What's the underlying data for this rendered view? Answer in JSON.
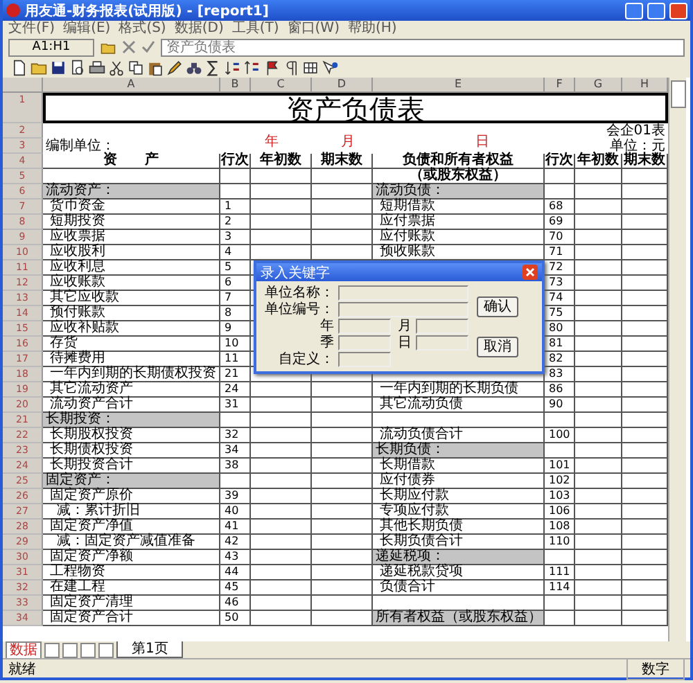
{
  "window": {
    "title": "用友通-财务报表(试用版) - [report1]"
  },
  "menu": [
    "文件(F)",
    "编辑(E)",
    "格式(S)",
    "数据(D)",
    "工具(T)",
    "窗口(W)",
    "帮助(H)"
  ],
  "formula_bar": {
    "cell": "A1:H1",
    "content": "资产负债表"
  },
  "columns": [
    "A",
    "B",
    "C",
    "D",
    "E",
    "F",
    "G",
    "H"
  ],
  "sheet": {
    "top_rows": [
      "1",
      "2",
      "3",
      "4",
      "5"
    ],
    "title": "资产负债表",
    "form_no": "会企01表",
    "unit_label": "编制单位：",
    "date_parts": [
      "年",
      "月",
      "日"
    ],
    "currency": "单位：元",
    "header": [
      "资　　产",
      "行次",
      "年初数",
      "期末数",
      "负债和所有者权益",
      "行次",
      "年初数",
      "期末数"
    ],
    "header2": "（或股东权益）",
    "rows": [
      {
        "num": "6",
        "asset": {
          "kind": "section",
          "text": "流动资产："
        },
        "liab": {
          "kind": "section",
          "text": "流动负债："
        }
      },
      {
        "num": "7",
        "asset": {
          "kind": "item",
          "text": "货币资金",
          "line": "1"
        },
        "liab": {
          "kind": "item",
          "text": "短期借款",
          "line": "68"
        }
      },
      {
        "num": "8",
        "asset": {
          "kind": "item",
          "text": "短期投资",
          "line": "2"
        },
        "liab": {
          "kind": "item",
          "text": "应付票据",
          "line": "69"
        }
      },
      {
        "num": "9",
        "asset": {
          "kind": "item",
          "text": "应收票据",
          "line": "3"
        },
        "liab": {
          "kind": "item",
          "text": "应付账款",
          "line": "70"
        }
      },
      {
        "num": "10",
        "asset": {
          "kind": "item",
          "text": "应收股利",
          "line": "4"
        },
        "liab": {
          "kind": "item",
          "text": "预收账款",
          "line": "71"
        }
      },
      {
        "num": "11",
        "asset": {
          "kind": "item",
          "text": "应收利息",
          "line": "5"
        },
        "liab": {
          "kind": "item",
          "line": "72"
        }
      },
      {
        "num": "12",
        "asset": {
          "kind": "item",
          "text": "应收账款",
          "line": "6"
        },
        "liab": {
          "kind": "item",
          "line": "73"
        }
      },
      {
        "num": "13",
        "asset": {
          "kind": "item",
          "text": "其它应收款",
          "line": "7"
        },
        "liab": {
          "kind": "item",
          "line": "74"
        }
      },
      {
        "num": "14",
        "asset": {
          "kind": "item",
          "text": "预付账款",
          "line": "8"
        },
        "liab": {
          "kind": "item",
          "line": "75"
        }
      },
      {
        "num": "15",
        "asset": {
          "kind": "item",
          "text": "应收补贴款",
          "line": "9"
        },
        "liab": {
          "kind": "item",
          "line": "80"
        }
      },
      {
        "num": "16",
        "asset": {
          "kind": "item",
          "text": "存货",
          "line": "10"
        },
        "liab": {
          "kind": "item",
          "line": "81"
        }
      },
      {
        "num": "17",
        "asset": {
          "kind": "item",
          "text": "待摊费用",
          "line": "11"
        },
        "liab": {
          "kind": "item",
          "line": "82"
        }
      },
      {
        "num": "18",
        "asset": {
          "kind": "item",
          "text": "一年内到期的长期债权投资",
          "line": "21"
        },
        "liab": {
          "kind": "item",
          "line": "83"
        }
      },
      {
        "num": "19",
        "asset": {
          "kind": "item",
          "text": "其它流动资产",
          "line": "24"
        },
        "liab": {
          "kind": "item",
          "text": "一年内到期的长期负债",
          "line": "86"
        }
      },
      {
        "num": "20",
        "asset": {
          "kind": "item",
          "text": "流动资产合计",
          "line": "31"
        },
        "liab": {
          "kind": "item",
          "text": "其它流动负债",
          "line": "90"
        }
      },
      {
        "num": "21",
        "asset": {
          "kind": "section",
          "text": "长期投资："
        },
        "liab": {
          "kind": "item"
        }
      },
      {
        "num": "22",
        "asset": {
          "kind": "item",
          "text": "长期股权投资",
          "line": "32"
        },
        "liab": {
          "kind": "item",
          "text": "流动负债合计",
          "line": "100"
        }
      },
      {
        "num": "23",
        "asset": {
          "kind": "item",
          "text": "长期债权投资",
          "line": "34"
        },
        "liab": {
          "kind": "section",
          "text": "长期负债："
        }
      },
      {
        "num": "24",
        "asset": {
          "kind": "item",
          "text": "长期投资合计",
          "line": "38"
        },
        "liab": {
          "kind": "item",
          "text": "长期借款",
          "line": "101"
        }
      },
      {
        "num": "25",
        "asset": {
          "kind": "section",
          "text": "固定资产："
        },
        "liab": {
          "kind": "item",
          "text": "应付债券",
          "line": "102"
        }
      },
      {
        "num": "26",
        "asset": {
          "kind": "item",
          "text": "固定资产原价",
          "line": "39"
        },
        "liab": {
          "kind": "item",
          "text": "长期应付款",
          "line": "103"
        }
      },
      {
        "num": "27",
        "asset": {
          "kind": "sub",
          "text": "减：累计折旧",
          "line": "40"
        },
        "liab": {
          "kind": "item",
          "text": "专项应付款",
          "line": "106"
        }
      },
      {
        "num": "28",
        "asset": {
          "kind": "item",
          "text": "固定资产净值",
          "line": "41"
        },
        "liab": {
          "kind": "item",
          "text": "其他长期负债",
          "line": "108"
        }
      },
      {
        "num": "29",
        "asset": {
          "kind": "sub",
          "text": "减：固定资产减值准备",
          "line": "42"
        },
        "liab": {
          "kind": "item",
          "text": "长期负债合计",
          "line": "110"
        }
      },
      {
        "num": "30",
        "asset": {
          "kind": "item",
          "text": "固定资产净额",
          "line": "43"
        },
        "liab": {
          "kind": "section",
          "text": "递延税项："
        }
      },
      {
        "num": "31",
        "asset": {
          "kind": "item",
          "text": "工程物资",
          "line": "44"
        },
        "liab": {
          "kind": "item",
          "text": "递延税款贷项",
          "line": "111"
        }
      },
      {
        "num": "32",
        "asset": {
          "kind": "item",
          "text": "在建工程",
          "line": "45"
        },
        "liab": {
          "kind": "item",
          "text": "负债合计",
          "line": "114"
        }
      },
      {
        "num": "33",
        "asset": {
          "kind": "item",
          "text": "固定资产清理",
          "line": "46"
        },
        "liab": {
          "kind": "item"
        }
      },
      {
        "num": "34",
        "asset": {
          "kind": "item",
          "text": "固定资产合计",
          "line": "50"
        },
        "liab": {
          "kind": "section",
          "text": "所有者权益（或股东权益）"
        }
      }
    ]
  },
  "dialog": {
    "title": "录入关键字",
    "fields": [
      {
        "label": "单位名称：",
        "kind": "wide"
      },
      {
        "label": "单位编号：",
        "kind": "wide"
      },
      {
        "label": "年",
        "kind": "half"
      },
      {
        "label": "月",
        "kind": "half"
      },
      {
        "label": "季",
        "kind": "half"
      },
      {
        "label": "日",
        "kind": "half"
      },
      {
        "label": "自定义：",
        "kind": "half"
      }
    ],
    "buttons": [
      "确认",
      "取消"
    ]
  },
  "sheet_tabs": {
    "mode": "数据",
    "tabs": [
      {
        "label": "第1页",
        "selected": true
      }
    ]
  },
  "status_bar": {
    "left": "就绪",
    "right": "数字"
  }
}
